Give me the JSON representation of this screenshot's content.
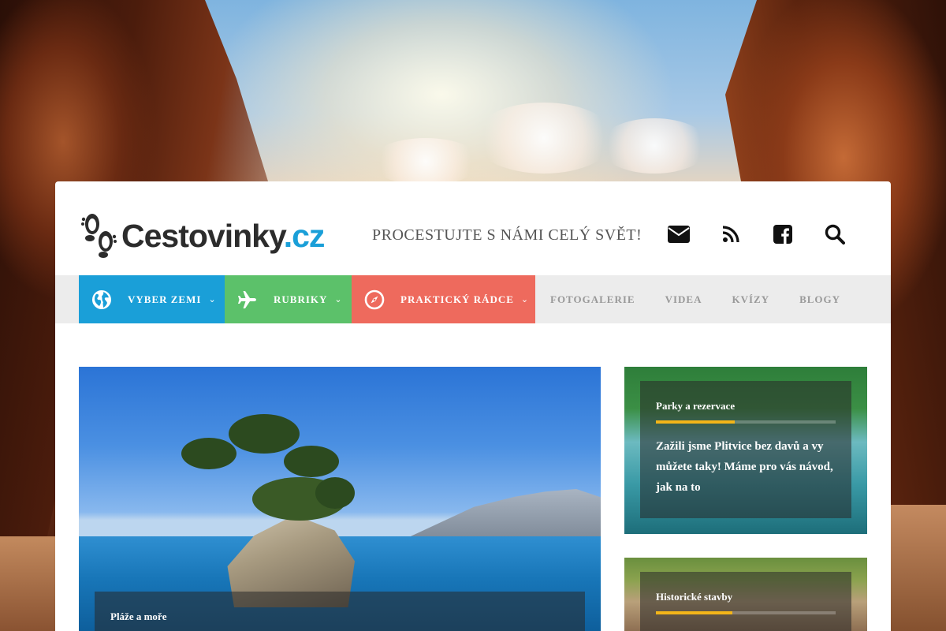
{
  "header": {
    "logo_text_main": "Cestovinky",
    "logo_text_domain": ".cz",
    "tagline": "PROCESTUJTE S NÁMI CELÝ SVĚT!",
    "icons": [
      "envelope-icon",
      "rss-icon",
      "facebook-icon",
      "search-icon"
    ]
  },
  "nav": {
    "main": [
      {
        "label": "VYBER ZEMI",
        "icon": "globe-icon",
        "color": "#1a9fd8"
      },
      {
        "label": "RUBRIKY",
        "icon": "plane-icon",
        "color": "#5cc16a"
      },
      {
        "label": "PRAKTICKÝ RÁDCE",
        "icon": "compass-icon",
        "color": "#ee6a5d"
      }
    ],
    "plain": [
      "FOTOGALERIE",
      "VIDEA",
      "KVÍZY",
      "BLOGY"
    ]
  },
  "featured": {
    "category": "Pláže a moře"
  },
  "side_articles": [
    {
      "category": "Parky a rezervace",
      "title": "Zažili jsme Plitvice bez davů a vy můžete taky! Máme pro vás návod, jak na to",
      "accent": "#f3b519"
    },
    {
      "category": "Historické stavby",
      "accent": "#f3b519"
    }
  ]
}
